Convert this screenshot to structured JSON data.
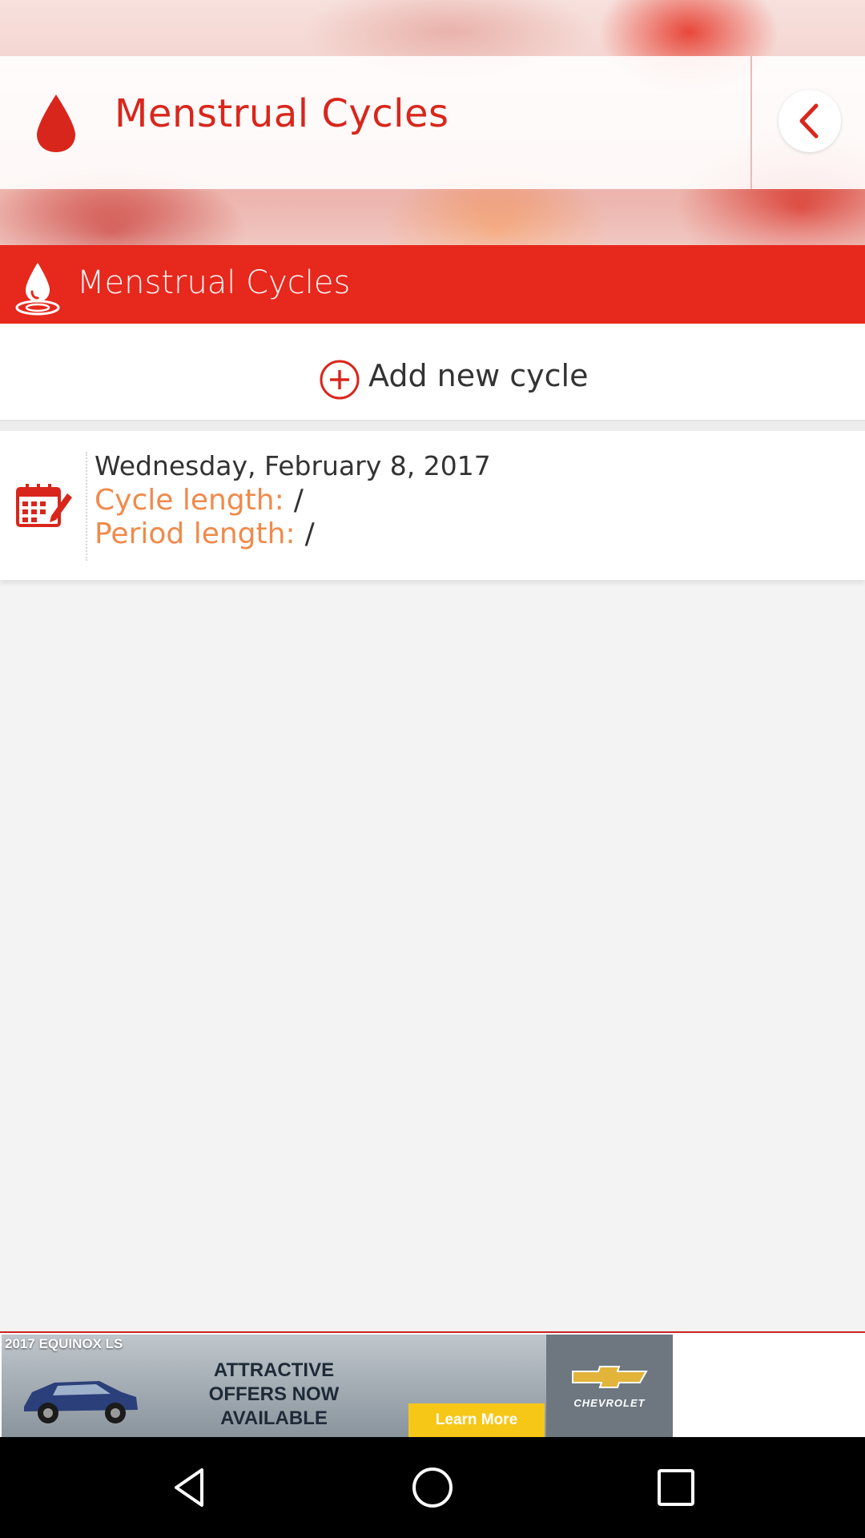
{
  "app": {
    "title": "Menstrual Cycles"
  },
  "section": {
    "title": "Menstrual Cycles"
  },
  "actions": {
    "add_label": "Add new cycle"
  },
  "cycles": [
    {
      "date": "Wednesday, February 8, 2017",
      "cycle_length_label": "Cycle length:",
      "cycle_length_value": "/",
      "period_length_label": "Period length:",
      "period_length_value": "/"
    }
  ],
  "ad": {
    "model": "2017 EQUINOX LS",
    "headline": "ATTRACTIVE OFFERS NOW AVAILABLE",
    "cta": "Learn More",
    "brand": "CHEVROLET"
  },
  "colors": {
    "accent_red": "#e7281d",
    "label_orange": "#f08a4b"
  },
  "icons": {
    "app": "drop-icon",
    "back": "chevron-left-icon",
    "section": "water-drop-icon",
    "add": "plus-circle-icon",
    "calendar": "calendar-edit-icon"
  }
}
